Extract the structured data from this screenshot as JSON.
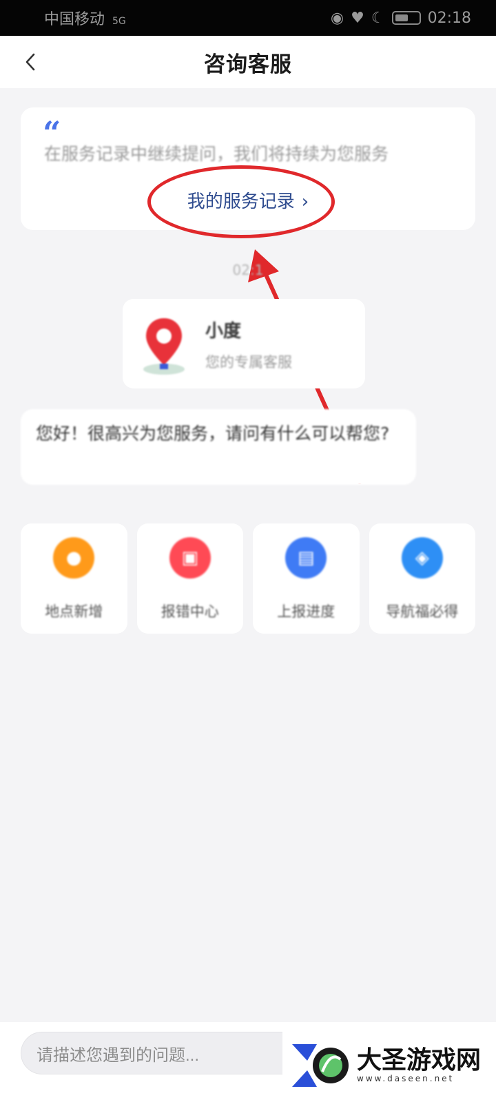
{
  "status_bar": {
    "carrier": "中国移动",
    "network": "5G",
    "time": "02:18"
  },
  "nav": {
    "back_icon": "chevron-left-icon",
    "title": "咨询客服"
  },
  "info_card": {
    "desc": "在服务记录中继续提问，我们将持续为您服务",
    "link_label": "我的服务记录",
    "link_chevron": "›"
  },
  "timestamp": "02:1",
  "agent": {
    "name": "小度",
    "role": "您的专属客服"
  },
  "greeting": "您好！很高兴为您服务，请问有什么可以帮您?",
  "services": [
    {
      "label": "地点新增",
      "color": "#ff9a1a",
      "icon": "pin-icon"
    },
    {
      "label": "报错中心",
      "color": "#ff4a55",
      "icon": "report-icon"
    },
    {
      "label": "上报进度",
      "color": "#3f7bf5",
      "icon": "progress-icon"
    },
    {
      "label": "导航福必得",
      "color": "#2e8ff5",
      "icon": "navigation-icon"
    }
  ],
  "input": {
    "placeholder": "请描述您遇到的问题..."
  },
  "watermark": {
    "name": "大圣游戏网",
    "url": "www.daseen.net"
  },
  "colors": {
    "highlight": "#e0282b",
    "link": "#2f4c8f",
    "accent": "#4a73e8"
  }
}
